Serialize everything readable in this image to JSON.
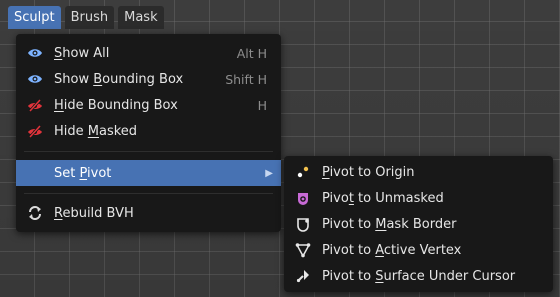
{
  "tabs": [
    {
      "label": "Sculpt",
      "active": true
    },
    {
      "label": "Brush",
      "active": false
    },
    {
      "label": "Mask",
      "active": false
    }
  ],
  "menu": {
    "items": [
      {
        "label_pre": "",
        "label_ul": "S",
        "label_post": "how All",
        "shortcut": "Alt H",
        "icon": "eye-icon"
      },
      {
        "label_pre": "Show ",
        "label_ul": "B",
        "label_post": "ounding Box",
        "shortcut": "Shift H",
        "icon": "eye-icon"
      },
      {
        "label_pre": "",
        "label_ul": "H",
        "label_post": "ide Bounding Box",
        "shortcut": "H",
        "icon": "eye-hidden-icon"
      },
      {
        "label_pre": "Hide ",
        "label_ul": "M",
        "label_post": "asked",
        "shortcut": "",
        "icon": "eye-hidden-icon"
      },
      {
        "label_pre": "Set ",
        "label_ul": "P",
        "label_post": "ivot",
        "shortcut": "",
        "icon": "",
        "submenu": true
      },
      {
        "label_pre": "",
        "label_ul": "R",
        "label_post": "ebuild BVH",
        "shortcut": "",
        "icon": "refresh-icon"
      }
    ]
  },
  "submenu": {
    "items": [
      {
        "label_pre": "",
        "label_ul": "P",
        "label_post": "ivot to Origin",
        "icon": "origin-icon"
      },
      {
        "label_pre": "Pivo",
        "label_ul": "t",
        "label_post": " to Unmasked",
        "icon": "unmasked-icon"
      },
      {
        "label_pre": "Pivot to ",
        "label_ul": "M",
        "label_post": "ask Border",
        "icon": "mask-border-icon"
      },
      {
        "label_pre": "Pivot to ",
        "label_ul": "A",
        "label_post": "ctive Vertex",
        "icon": "active-vertex-icon"
      },
      {
        "label_pre": "Pivot to ",
        "label_ul": "S",
        "label_post": "urface Under Cursor",
        "icon": "cursor-icon"
      }
    ]
  },
  "colors": {
    "accent": "#4772b3",
    "menu_bg": "#181818",
    "eye": "#7db3ff",
    "hidden": "#e0333b",
    "unmasked": "#c86ad6",
    "origin": "#f2c14e"
  }
}
